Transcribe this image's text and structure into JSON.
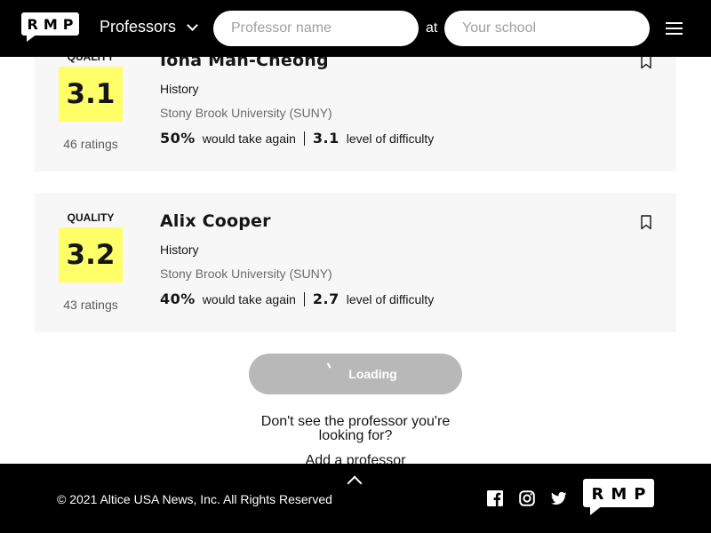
{
  "header": {
    "logo_text": "RMP",
    "nav_label": "Professors",
    "professor_placeholder": "Professor name",
    "at_label": "at",
    "school_placeholder": "Your school"
  },
  "professors": [
    {
      "quality_label": "QUALITY",
      "quality": "3.1",
      "ratings": "46 ratings",
      "name": "Iona Man-Cheong",
      "department": "History",
      "school": "Stony Brook University (SUNY)",
      "would_take_again": "50%",
      "would_take_again_label": "would take again",
      "difficulty": "3.1",
      "difficulty_label": "level of difficulty"
    },
    {
      "quality_label": "QUALITY",
      "quality": "3.2",
      "ratings": "43 ratings",
      "name": "Alix Cooper",
      "department": "History",
      "school": "Stony Brook University (SUNY)",
      "would_take_again": "40%",
      "would_take_again_label": "would take again",
      "difficulty": "2.7",
      "difficulty_label": "level of difficulty"
    }
  ],
  "loading_label": "Loading",
  "missing_text": "Don't see the professor you're looking for?",
  "add_link": "Add a professor",
  "footer": {
    "copyright": "© 2021 Altice USA News, Inc. All Rights Reserved",
    "logo_text": "RMP"
  },
  "colors": {
    "header_bg": "#000000",
    "card_bg": "#f7f7f7",
    "quality_yellow": "#ffff68",
    "loading_button": "#b8b8b8"
  },
  "icons": [
    "chevron-down-icon",
    "menu-icon",
    "bookmark-icon",
    "spinner-icon",
    "chevron-up-icon",
    "facebook-icon",
    "instagram-icon",
    "twitter-icon"
  ]
}
